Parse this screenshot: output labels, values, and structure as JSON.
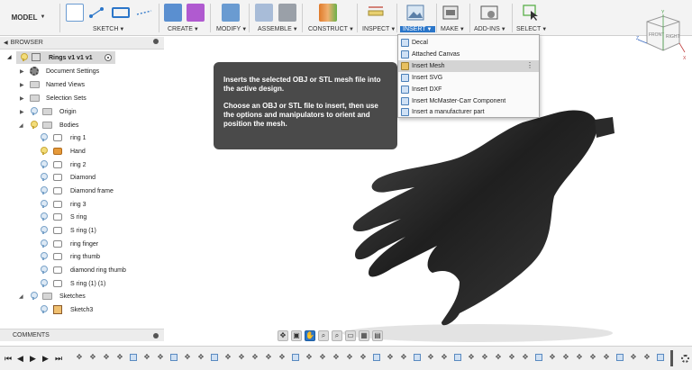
{
  "toolbar": {
    "model": "MODEL",
    "groups": [
      {
        "label": "SKETCH"
      },
      {
        "label": "CREATE"
      },
      {
        "label": "MODIFY"
      },
      {
        "label": "ASSEMBLE"
      },
      {
        "label": "CONSTRUCT"
      },
      {
        "label": "INSPECT"
      },
      {
        "label": "INSERT"
      },
      {
        "label": "MAKE"
      },
      {
        "label": "ADD-INS"
      },
      {
        "label": "SELECT"
      }
    ]
  },
  "browser": {
    "title": "BROWSER",
    "root": "Rings v1 v1 v1",
    "items": [
      {
        "label": "Document Settings"
      },
      {
        "label": "Named Views"
      },
      {
        "label": "Selection Sets"
      },
      {
        "label": "Origin"
      },
      {
        "label": "Bodies"
      },
      {
        "label": "ring 1"
      },
      {
        "label": "Hand"
      },
      {
        "label": "ring 2"
      },
      {
        "label": "Diamond"
      },
      {
        "label": "Diamond frame"
      },
      {
        "label": "ring 3"
      },
      {
        "label": "S ring"
      },
      {
        "label": "S ring (1)"
      },
      {
        "label": "ring finger"
      },
      {
        "label": "ring thumb"
      },
      {
        "label": "diamond ring thumb"
      },
      {
        "label": "S ring (1) (1)"
      },
      {
        "label": "Sketches"
      },
      {
        "label": "Sketch3"
      }
    ]
  },
  "comments": {
    "title": "COMMENTS"
  },
  "tooltip": {
    "line1": "Inserts the selected OBJ or STL mesh file into the active design.",
    "line2": "Choose an OBJ or STL file to insert, then use the options and manipulators to orient and position the mesh."
  },
  "insert_menu": {
    "items": [
      {
        "label": "Decal"
      },
      {
        "label": "Attached Canvas"
      },
      {
        "label": "Insert Mesh"
      },
      {
        "label": "Insert SVG"
      },
      {
        "label": "Insert DXF"
      },
      {
        "label": "Insert McMaster-Carr Component"
      },
      {
        "label": "Insert a manufacturer part"
      }
    ]
  },
  "viewcube": {
    "front": "FRONT",
    "right": "RIGHT",
    "axis_x": "X",
    "axis_y": "Y",
    "axis_z": "Z"
  },
  "colors": {
    "accent": "#2b76c9",
    "tooltip_bg": "#4a4a4a",
    "hand": "#2a2a2a"
  }
}
